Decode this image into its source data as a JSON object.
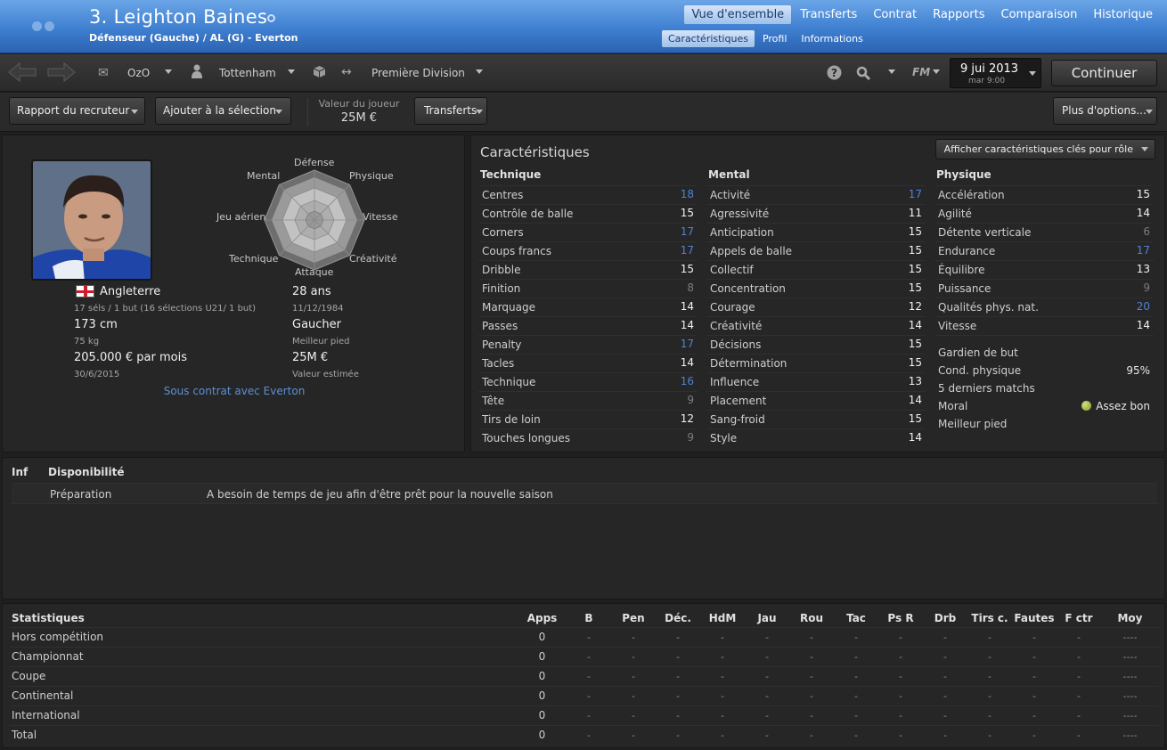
{
  "header": {
    "player_name": "3. Leighton Baines",
    "subtitle": "Défenseur (Gauche) / AL (G) - Everton",
    "tabs": [
      "Vue d'ensemble",
      "Transferts",
      "Contrat",
      "Rapports",
      "Comparaison",
      "Historique"
    ],
    "subtabs": [
      "Caractéristiques",
      "Profil",
      "Informations"
    ],
    "brand_color": "#3f7fd0"
  },
  "toolbar": {
    "manager": "OzO",
    "club": "Tottenham",
    "league": "Première Division",
    "date_main": "9 jui 2013",
    "date_sub": "mar 9:00",
    "fm_label": "FM",
    "continue_label": "Continuer"
  },
  "actions": {
    "scout_report": "Rapport du recruteur",
    "add_selection": "Ajouter à la sélection",
    "value_label": "Valeur du joueur",
    "value": "25M €",
    "transfers": "Transferts",
    "more_options": "Plus d'options..."
  },
  "profile": {
    "radar_labels": [
      "Défense",
      "Physique",
      "Vitesse",
      "Créativité",
      "Attaque",
      "Technique",
      "Jeu aérien",
      "Mental"
    ],
    "nationality": "Angleterre",
    "caps": "17 séls / 1 but (16 sélections U21/ 1 but)",
    "height": "173 cm",
    "weight": "75 kg",
    "wage": "205.000 € par mois",
    "contract_end": "30/6/2015",
    "age": "28 ans",
    "birth_date": "11/12/1984",
    "foot": "Gaucher",
    "foot_label": "Meilleur pied",
    "est_value": "25M €",
    "est_value_label": "Valeur estimée",
    "contract_link": "Sous contrat avec Everton"
  },
  "attributes": {
    "title": "Caractéristiques",
    "role_button": "Afficher caractéristiques clés pour rôle",
    "technique": {
      "header": "Technique",
      "rows": [
        {
          "name": "Centres",
          "value": "18"
        },
        {
          "name": "Contrôle de balle",
          "value": "15"
        },
        {
          "name": "Corners",
          "value": "17"
        },
        {
          "name": "Coups francs",
          "value": "17"
        },
        {
          "name": "Dribble",
          "value": "15"
        },
        {
          "name": "Finition",
          "value": "8"
        },
        {
          "name": "Marquage",
          "value": "14"
        },
        {
          "name": "Passes",
          "value": "14"
        },
        {
          "name": "Penalty",
          "value": "17"
        },
        {
          "name": "Tacles",
          "value": "14"
        },
        {
          "name": "Technique",
          "value": "16"
        },
        {
          "name": "Tête",
          "value": "9"
        },
        {
          "name": "Tirs de loin",
          "value": "12"
        },
        {
          "name": "Touches longues",
          "value": "9"
        }
      ]
    },
    "mental": {
      "header": "Mental",
      "rows": [
        {
          "name": "Activité",
          "value": "17"
        },
        {
          "name": "Agressivité",
          "value": "11"
        },
        {
          "name": "Anticipation",
          "value": "15"
        },
        {
          "name": "Appels de balle",
          "value": "15"
        },
        {
          "name": "Collectif",
          "value": "15"
        },
        {
          "name": "Concentration",
          "value": "15"
        },
        {
          "name": "Courage",
          "value": "12"
        },
        {
          "name": "Créativité",
          "value": "14"
        },
        {
          "name": "Décisions",
          "value": "15"
        },
        {
          "name": "Détermination",
          "value": "15"
        },
        {
          "name": "Influence",
          "value": "13"
        },
        {
          "name": "Placement",
          "value": "14"
        },
        {
          "name": "Sang-froid",
          "value": "15"
        },
        {
          "name": "Style",
          "value": "14"
        }
      ]
    },
    "physique": {
      "header": "Physique",
      "rows": [
        {
          "name": "Accélération",
          "value": "15"
        },
        {
          "name": "Agilité",
          "value": "14"
        },
        {
          "name": "Détente verticale",
          "value": "6"
        },
        {
          "name": "Endurance",
          "value": "17"
        },
        {
          "name": "Équilibre",
          "value": "13"
        },
        {
          "name": "Puissance",
          "value": "9"
        },
        {
          "name": "Qualités phys. nat.",
          "value": "20"
        },
        {
          "name": "Vitesse",
          "value": "14"
        }
      ]
    },
    "extra": {
      "goalkeeper": "Gardien de but",
      "condition_label": "Cond. physique",
      "condition_value": "95%",
      "last5": "5 derniers matchs",
      "morale_label": "Moral",
      "morale_value": "Assez bon",
      "best_foot": "Meilleur pied"
    },
    "colors": {
      "high": "#4f82d9",
      "low": "#7d7d7d"
    }
  },
  "availability": {
    "col1": "Inf",
    "col2": "Disponibilité",
    "row_key": "Préparation",
    "row_value": "A besoin de temps de jeu afin d'être prêt pour la nouvelle saison"
  },
  "stats": {
    "headers": [
      "Statistiques",
      "Apps",
      "B",
      "Pen",
      "Déc.",
      "HdM",
      "Jau",
      "Rou",
      "Tac",
      "Ps R",
      "Drb",
      "Tirs c.",
      "Fautes",
      "F ctr",
      "Moy"
    ],
    "rows": [
      [
        "Hors compétition",
        "0",
        "-",
        "-",
        "-",
        "-",
        "-",
        "-",
        "-",
        "-",
        "-",
        "-",
        "-",
        "-",
        "----"
      ],
      [
        "Championnat",
        "0",
        "-",
        "-",
        "-",
        "-",
        "-",
        "-",
        "-",
        "-",
        "-",
        "-",
        "-",
        "-",
        "----"
      ],
      [
        "Coupe",
        "0",
        "-",
        "-",
        "-",
        "-",
        "-",
        "-",
        "-",
        "-",
        "-",
        "-",
        "-",
        "-",
        "----"
      ],
      [
        "Continental",
        "0",
        "-",
        "-",
        "-",
        "-",
        "-",
        "-",
        "-",
        "-",
        "-",
        "-",
        "-",
        "-",
        "----"
      ],
      [
        "International",
        "0",
        "-",
        "-",
        "-",
        "-",
        "-",
        "-",
        "-",
        "-",
        "-",
        "-",
        "-",
        "-",
        "----"
      ],
      [
        "Total",
        "0",
        "-",
        "-",
        "-",
        "-",
        "-",
        "-",
        "-",
        "-",
        "-",
        "-",
        "-",
        "-",
        "----"
      ]
    ]
  }
}
